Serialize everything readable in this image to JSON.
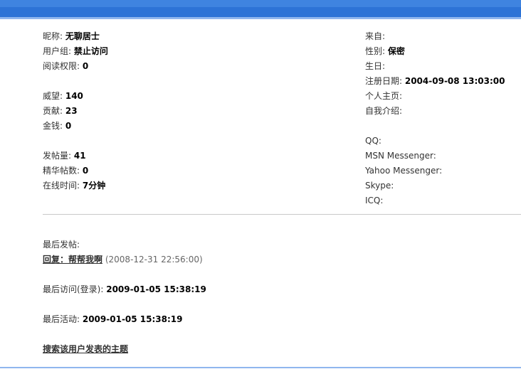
{
  "left": {
    "nickname": {
      "label": "昵称: ",
      "value": "无聊居士"
    },
    "group": {
      "label": "用户组: ",
      "value": "禁止访问"
    },
    "read_perm": {
      "label": "阅读权限: ",
      "value": "0"
    },
    "prestige": {
      "label": "威望: ",
      "value": "140"
    },
    "contribution": {
      "label": "贡献: ",
      "value": "23"
    },
    "money": {
      "label": "金钱: ",
      "value": "0"
    },
    "posts": {
      "label": "发帖量: ",
      "value": "41"
    },
    "digest": {
      "label": "精华帖数: ",
      "value": "0"
    },
    "online": {
      "label": "在线时间: ",
      "value": "7分钟"
    }
  },
  "right": {
    "from": {
      "label": "来自:",
      "value": ""
    },
    "gender": {
      "label": "性别: ",
      "value": "保密"
    },
    "birthday": {
      "label": "生日:",
      "value": ""
    },
    "reg_date": {
      "label": "注册日期: ",
      "value": "2004-09-08 13:03:00"
    },
    "homepage": {
      "label": "个人主页:",
      "value": ""
    },
    "intro": {
      "label": "自我介绍:",
      "value": ""
    },
    "qq": {
      "label": "QQ:",
      "value": ""
    },
    "msn": {
      "label": "MSN Messenger:",
      "value": ""
    },
    "yahoo": {
      "label": "Yahoo Messenger:",
      "value": ""
    },
    "skype": {
      "label": "Skype:",
      "value": ""
    },
    "icq": {
      "label": "ICQ:",
      "value": ""
    }
  },
  "activity": {
    "last_post_label": "最后发帖:",
    "last_post_link": "回复：帮帮我啊",
    "last_post_time": "(2008-12-31 22:56:00)",
    "last_visit_label": "最后访问(登录): ",
    "last_visit_value": "2009-01-05 15:38:19",
    "last_active_label": "最后活动: ",
    "last_active_value": "2009-01-05 15:38:19",
    "search_link": "搜索该用户发表的主题"
  },
  "colors": {
    "topbar": "#2d73d6",
    "divider": "#c8c8c8"
  }
}
